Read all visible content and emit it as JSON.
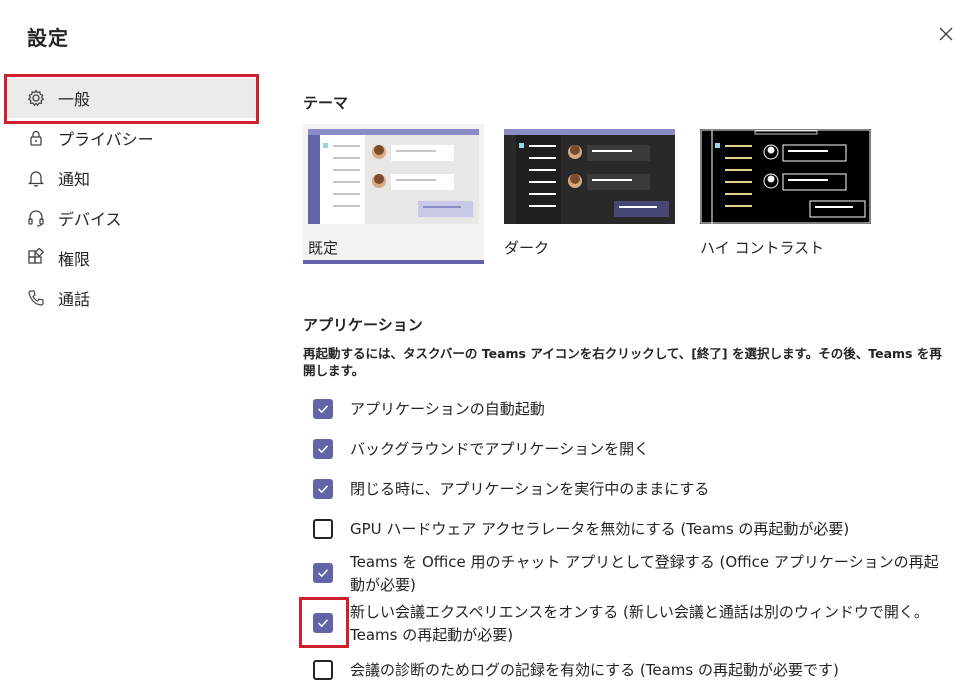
{
  "dialog": {
    "title": "設定"
  },
  "nav": {
    "items": [
      {
        "label": "一般",
        "icon": "gear-icon"
      },
      {
        "label": "プライバシー",
        "icon": "lock-icon"
      },
      {
        "label": "通知",
        "icon": "bell-icon"
      },
      {
        "label": "デバイス",
        "icon": "headset-icon"
      },
      {
        "label": "権限",
        "icon": "apps-icon"
      },
      {
        "label": "通話",
        "icon": "phone-icon"
      }
    ],
    "selected": "一般"
  },
  "theme": {
    "heading": "テーマ",
    "options": [
      {
        "label": "既定",
        "selected": true
      },
      {
        "label": "ダーク",
        "selected": false
      },
      {
        "label": "ハイ コントラスト",
        "selected": false
      }
    ]
  },
  "app": {
    "heading": "アプリケーション",
    "description": "再起動するには、タスクバーの Teams アイコンを右クリックして、[終了] を選択します。その後、Teams を再開します。",
    "options": [
      {
        "label": "アプリケーションの自動起動",
        "checked": true
      },
      {
        "label": "バックグラウンドでアプリケーションを開く",
        "checked": true
      },
      {
        "label": "閉じる時に、アプリケーションを実行中のままにする",
        "checked": true
      },
      {
        "label": "GPU ハードウェア アクセラレータを無効にする (Teams の再起動が必要)",
        "checked": false
      },
      {
        "label": "Teams を Office 用のチャット アプリとして登録する (Office アプリケーションの再起動が必要)",
        "checked": true
      },
      {
        "label": "新しい会議エクスペリエンスをオンする (新しい会議と通話は別のウィンドウで開く。Teams の再起動が必要)",
        "checked": true
      },
      {
        "label": "会議の診断のためログの記録を有効にする (Teams の再起動が必要です)",
        "checked": false
      }
    ]
  },
  "colors": {
    "accent": "#6264a7",
    "highlight": "#d0202d"
  }
}
